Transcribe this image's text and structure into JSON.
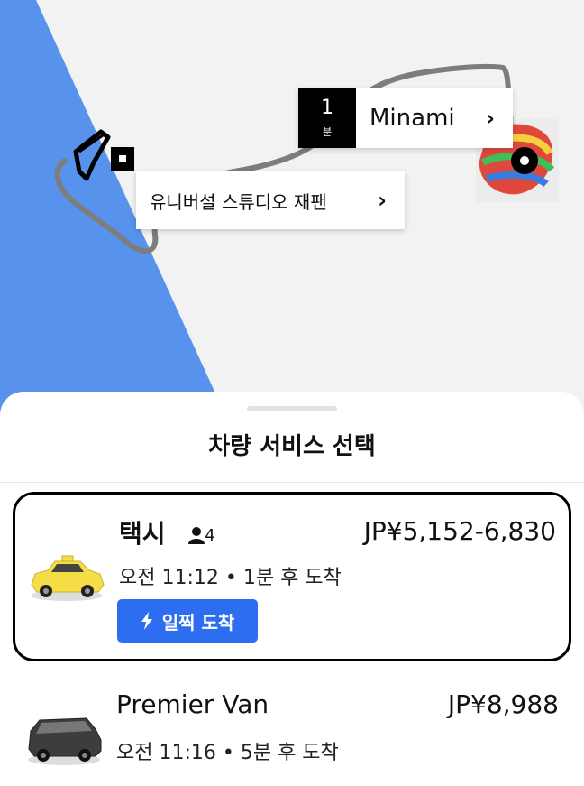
{
  "map": {
    "eta_value": "1",
    "eta_unit": "분",
    "pickup_name": "Minami",
    "destination_label": "유니버설 스튜디오 재팬",
    "water_color": "#5792ec",
    "route_color": "#7d7d7d"
  },
  "sheet": {
    "title": "차량 서비스 선택",
    "options": [
      {
        "name": "택시",
        "seats": "4",
        "price": "JP¥5,152-6,830",
        "eta": "오전 11:12 • 1분 후 도착",
        "badge": "일찍 도착",
        "badge_color": "#2d6df0",
        "car_color": "#f4dd45",
        "selected": true
      },
      {
        "name": "Premier Van",
        "price": "JP¥8,988",
        "eta": "오전 11:16 • 5분 후 도착",
        "car_color": "#3d3d3d",
        "selected": false
      }
    ]
  }
}
